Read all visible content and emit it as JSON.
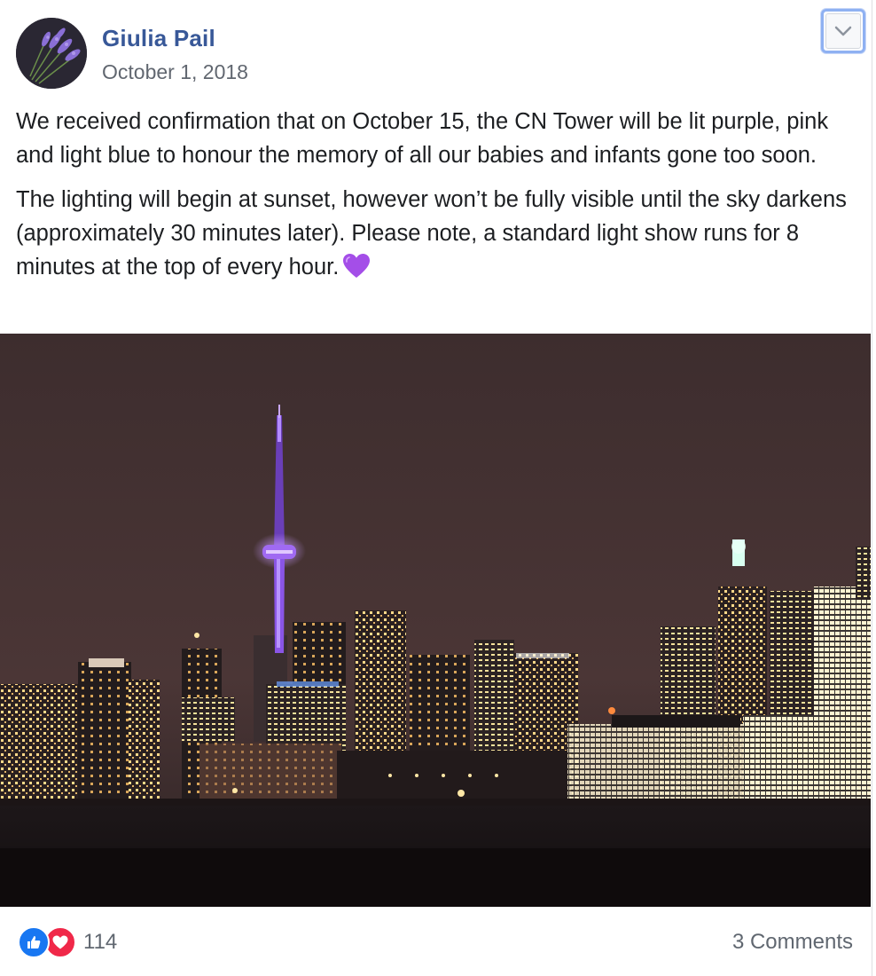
{
  "post": {
    "author": "Giulia Pail",
    "date": "October 1, 2018",
    "paragraphs": [
      "We received confirmation that on October 15, the CN Tower will be lit purple, pink and light blue to honour the memory of all our babies and infants gone too soon.",
      "The lighting will begin at sunset, however won’t be fully visible until the sky darkens (approximately 30 minutes later). Please note, a standard light show runs for 8 minutes at the top of every hour."
    ],
    "emoji": "purple-heart-icon"
  },
  "footer": {
    "reaction_count": "114",
    "comments_label": "3 Comments"
  },
  "colors": {
    "author_link": "#385898",
    "like_blue": "#1877f2",
    "love_red": "#f02849",
    "tower_purple": "#9b5cff"
  }
}
